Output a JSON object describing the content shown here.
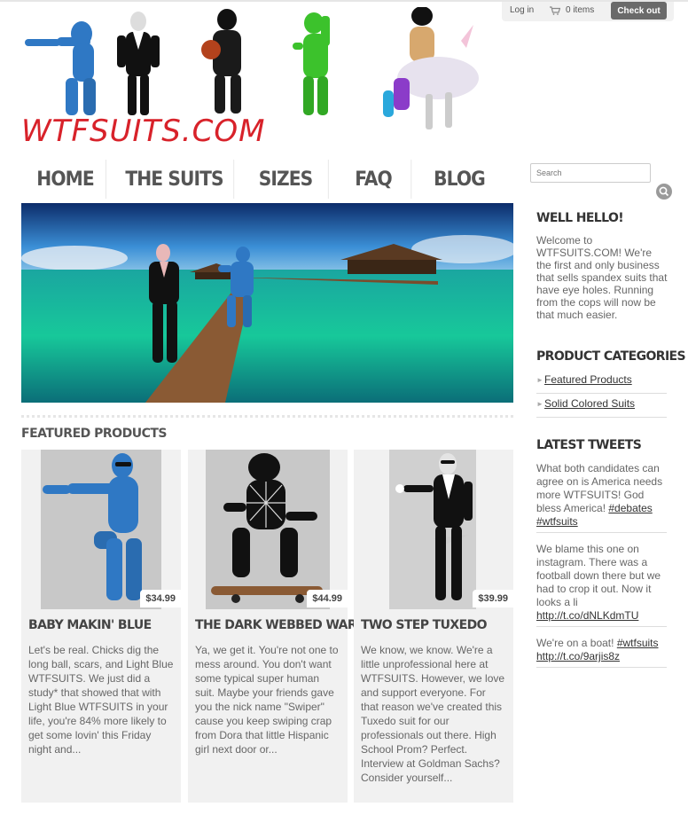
{
  "header": {
    "logo_text": "WTFSUITS.COM"
  },
  "account": {
    "login_label": "Log in",
    "cart_label": "0 items",
    "checkout_label": "Check out"
  },
  "nav": {
    "items": [
      "HOME",
      "THE SUITS",
      "SIZES",
      "FAQ",
      "BLOG"
    ]
  },
  "search": {
    "placeholder": "Search"
  },
  "featured": {
    "title": "FEATURED PRODUCTS",
    "products": [
      {
        "name": "BABY MAKIN' BLUE",
        "price": "$34.99",
        "description": "Let's be real. Chicks dig the long ball, scars, and Light Blue WTFSUITS. We just did a study* that showed that with Light Blue WTFSUITS in your life, you're 84% more likely to get some lovin' this Friday night and..."
      },
      {
        "name": "THE DARK WEBBED WARRIOR",
        "price": "$44.99",
        "description": "Ya, we get it. You're not one to mess around. You don't want some typical super human suit. Maybe your friends gave you the nick name \"Swiper\" cause you keep swiping crap from Dora that little Hispanic girl next door or..."
      },
      {
        "name": "TWO STEP TUXEDO",
        "price": "$39.99",
        "description": "We know, we know. We're a little unprofessional here at WTFSUITS. However, we love and support everyone. For that reason we've created this Tuxedo suit for our professionals out there. High School Prom? Perfect. Interview at Goldman Sachs? Consider yourself..."
      }
    ]
  },
  "sidebar": {
    "welcome_title": "WELL HELLO!",
    "welcome_text": "Welcome to WTFSUITS.COM! We're the first and only business that sells spandex suits that have eye holes. Running from the cops will now be that much easier.",
    "categories_title": "PRODUCT CATEGORIES",
    "categories": [
      "Featured Products",
      "Solid Colored Suits"
    ],
    "tweets_title": "LATEST TWEETS",
    "tweets": [
      {
        "text": "What both candidates can agree on is America needs more WTFSUITS! God bless America!",
        "links": [
          "#debates",
          "#wtfsuits"
        ]
      },
      {
        "text": "We blame this one on instagram. There was a football down there but we had to crop it out. Now it looks a li",
        "links": [
          "http://t.co/dNLKdmTU"
        ]
      },
      {
        "text": "We're on a boat!",
        "links": [
          "#wtfsuits",
          "http://t.co/9arjis8z"
        ]
      }
    ]
  }
}
